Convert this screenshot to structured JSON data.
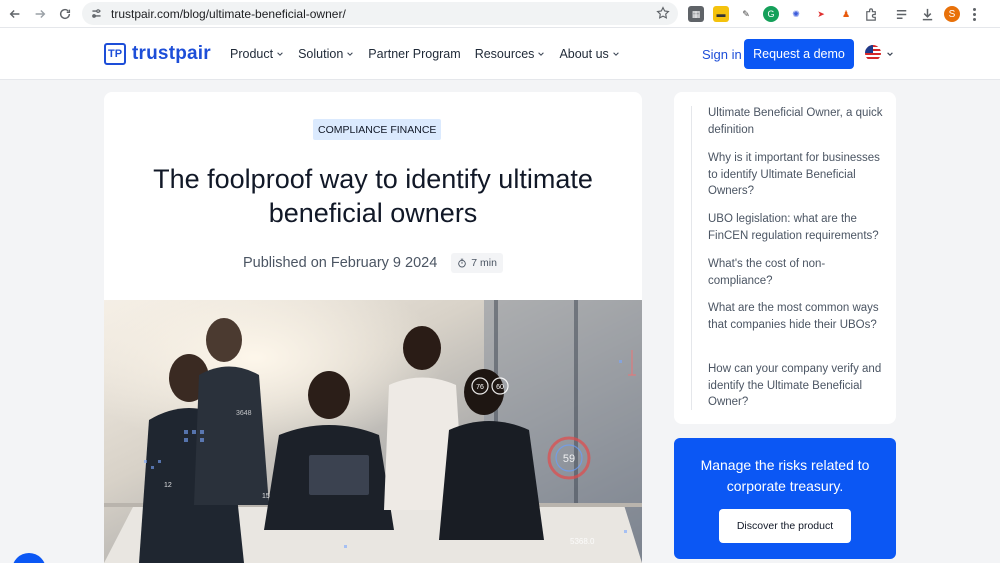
{
  "browser": {
    "url": "trustpair.com/blog/ultimate-beneficial-owner/",
    "profile_initial": "S"
  },
  "header": {
    "logo_text": "trustpair",
    "logo_mark": "TP",
    "nav": [
      {
        "label": "Product",
        "has_menu": true
      },
      {
        "label": "Solution",
        "has_menu": true
      },
      {
        "label": "Partner Program",
        "has_menu": false
      },
      {
        "label": "Resources",
        "has_menu": true
      },
      {
        "label": "About us",
        "has_menu": true
      }
    ],
    "sign_in": "Sign in",
    "demo_button": "Request a demo",
    "language_flag": "us-flag-icon"
  },
  "article": {
    "category": "COMPLIANCE FINANCE",
    "title_line1": "The foolproof way to identify ultimate",
    "title_line2": "beneficial owners",
    "published": "Published on February 9 2024",
    "read_time": "7 min",
    "hero_overlay": {
      "val_76": "76",
      "val_60": "60",
      "val_59": "59",
      "val_12": "12",
      "val_15": "15",
      "val_5368": "5368.0",
      "val_3648": "3648"
    }
  },
  "toc": {
    "items": [
      "Ultimate Beneficial Owner, a quick definition",
      "Why is it important for businesses to identify Ultimate Beneficial Owners?",
      "UBO legislation: what are the FinCEN regulation requirements?",
      "What's the cost of non-compliance?",
      "What are the most common ways that companies hide their UBOs?",
      "How can your company verify and identify the Ultimate Beneficial Owner?"
    ]
  },
  "cta": {
    "text": "Manage the risks related to corporate treasury.",
    "button": "Discover the product"
  },
  "colors": {
    "brand_blue": "#0b57f4",
    "logo_blue": "#1d4ed8",
    "badge_bg": "#dbeafe",
    "page_bg": "#f3f4f6"
  }
}
